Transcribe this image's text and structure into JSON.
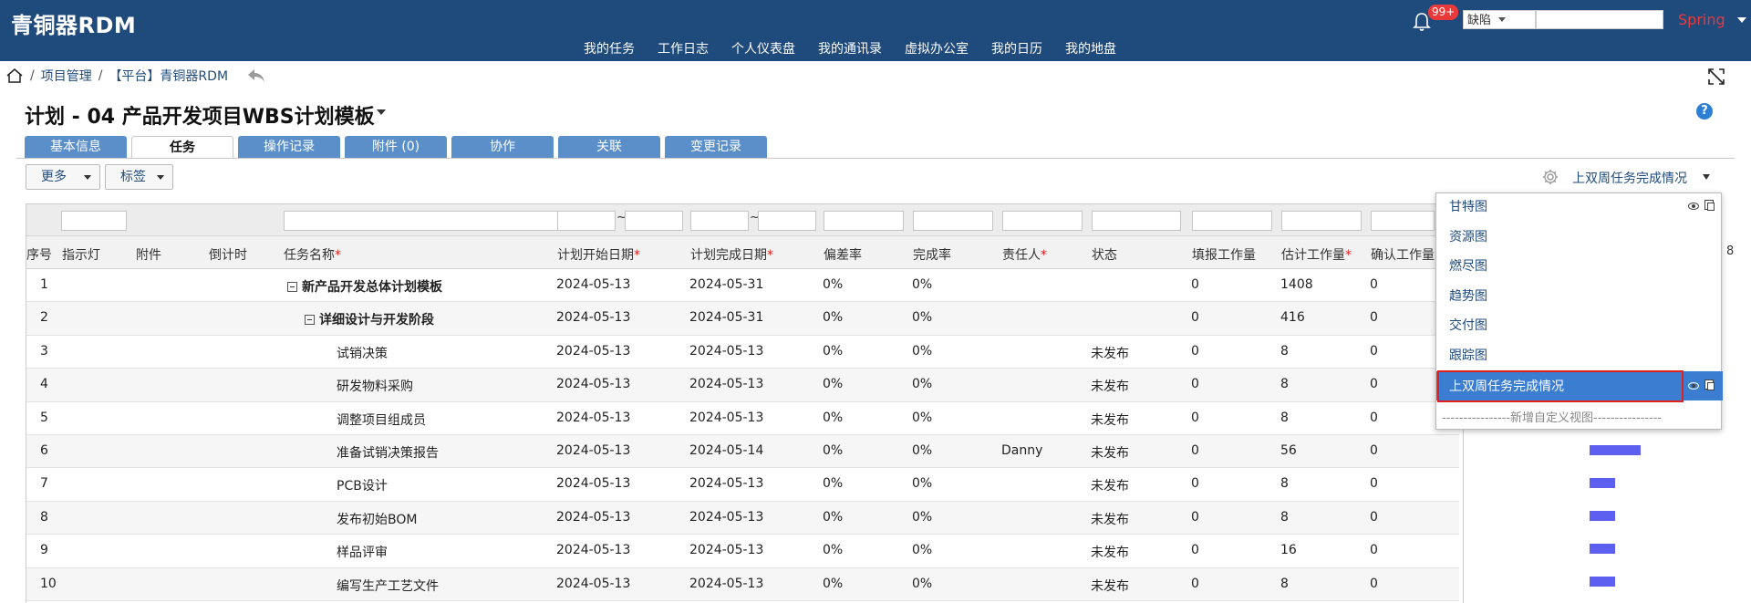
{
  "app": {
    "logo": "青铜器RDM",
    "notifications_badge": "99+",
    "search_scope": "缺陷",
    "user": "Spring"
  },
  "topnav": [
    "我的任务",
    "工作日志",
    "个人仪表盘",
    "我的通讯录",
    "虚拟办公室",
    "我的日历",
    "我的地盘"
  ],
  "breadcrumb": {
    "sep1": "/",
    "item1": "项目管理",
    "sep2": "/",
    "item2": "【平台】青铜器RDM"
  },
  "page": {
    "title": "计划 - 04 产品开发项目WBS计划模板",
    "help": "?"
  },
  "tabs": [
    "基本信息",
    "任务",
    "操作记录",
    "附件 (0)",
    "协作",
    "关联",
    "变更记录"
  ],
  "toolbar": {
    "more": "更多",
    "tags": "标签",
    "current_view": "上双周任务完成情况"
  },
  "grid": {
    "filter_tilde": "~",
    "headers": {
      "seq": "序号",
      "indicator": "指示灯",
      "attachment": "附件",
      "countdown": "倒计时",
      "task_name": "任务名称",
      "plan_start": "计划开始日期",
      "plan_end": "计划完成日期",
      "deviation": "偏差率",
      "completion": "完成率",
      "owner": "责任人",
      "status": "状态",
      "reported": "填报工作量",
      "estimated": "估计工作量",
      "confirmed": "确认工作量"
    },
    "required_mark": "*",
    "rows": [
      {
        "seq": "1",
        "name": "新产品开发总体计划模板",
        "start": "2024-05-13",
        "end": "2024-05-31",
        "dev": "0%",
        "comp": "0%",
        "owner": "",
        "status": "",
        "reported": "0",
        "estimated": "1408",
        "confirmed": "0"
      },
      {
        "seq": "2",
        "name": "详细设计与开发阶段",
        "start": "2024-05-13",
        "end": "2024-05-31",
        "dev": "0%",
        "comp": "0%",
        "owner": "",
        "status": "",
        "reported": "0",
        "estimated": "416",
        "confirmed": "0"
      },
      {
        "seq": "3",
        "name": "试销决策",
        "start": "2024-05-13",
        "end": "2024-05-13",
        "dev": "0%",
        "comp": "0%",
        "owner": "",
        "status": "未发布",
        "reported": "0",
        "estimated": "8",
        "confirmed": "0"
      },
      {
        "seq": "4",
        "name": "研发物料采购",
        "start": "2024-05-13",
        "end": "2024-05-13",
        "dev": "0%",
        "comp": "0%",
        "owner": "",
        "status": "未发布",
        "reported": "0",
        "estimated": "8",
        "confirmed": "0"
      },
      {
        "seq": "5",
        "name": "调整项目组成员",
        "start": "2024-05-13",
        "end": "2024-05-13",
        "dev": "0%",
        "comp": "0%",
        "owner": "",
        "status": "未发布",
        "reported": "0",
        "estimated": "8",
        "confirmed": "0"
      },
      {
        "seq": "6",
        "name": "准备试销决策报告",
        "start": "2024-05-13",
        "end": "2024-05-14",
        "dev": "0%",
        "comp": "0%",
        "owner": "Danny",
        "status": "未发布",
        "reported": "0",
        "estimated": "56",
        "confirmed": "0"
      },
      {
        "seq": "7",
        "name": "PCB设计",
        "start": "2024-05-13",
        "end": "2024-05-13",
        "dev": "0%",
        "comp": "0%",
        "owner": "",
        "status": "未发布",
        "reported": "0",
        "estimated": "8",
        "confirmed": "0"
      },
      {
        "seq": "8",
        "name": "发布初始BOM",
        "start": "2024-05-13",
        "end": "2024-05-13",
        "dev": "0%",
        "comp": "0%",
        "owner": "",
        "status": "未发布",
        "reported": "0",
        "estimated": "8",
        "confirmed": "0"
      },
      {
        "seq": "9",
        "name": "样品评审",
        "start": "2024-05-13",
        "end": "2024-05-13",
        "dev": "0%",
        "comp": "0%",
        "owner": "",
        "status": "未发布",
        "reported": "0",
        "estimated": "16",
        "confirmed": "0"
      },
      {
        "seq": "10",
        "name": "编写生产工艺文件",
        "start": "2024-05-13",
        "end": "2024-05-13",
        "dev": "0%",
        "comp": "0%",
        "owner": "",
        "status": "未发布",
        "reported": "0",
        "estimated": "8",
        "confirmed": "0"
      }
    ],
    "edge_digit": "8"
  },
  "view_dropdown": {
    "items": [
      "甘特图",
      "资源图",
      "燃尽图",
      "趋势图",
      "交付图",
      "跟踪图"
    ],
    "selected": "上双周任务完成情况",
    "add_custom": "----------------新增自定义视图----------------"
  },
  "colors": {
    "header_bg": "#1f4a7c",
    "tab_bg": "#5b8fc9",
    "selected_bg": "#3b7dd1",
    "highlight": "#e2201f",
    "gantt_bar": "#5d5ff0"
  }
}
